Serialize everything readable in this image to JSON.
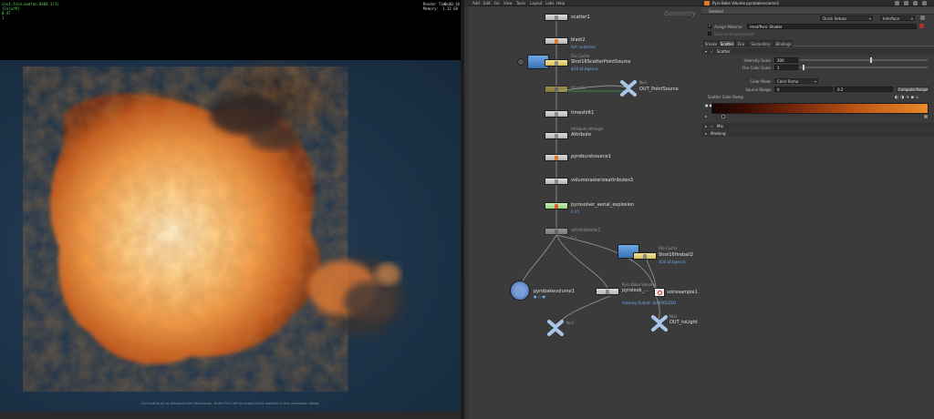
{
  "viewport": {
    "hud_left": [
      "cout.fold.andran.0404.1(1)",
      "[ColorM]",
      "0.47",
      "1"
    ],
    "render_time_label": "Render Time:",
    "render_time_value": "0:00:10",
    "memory_label": "Memory:",
    "memory_value": "1.12 GB",
    "hint_text": "Ctrl+Left to an on detailed pixel information. Shift+Ctrl+Left to inspect focus material in this permission dialog.",
    "colors": {
      "fire_core": "#fff1c9",
      "fire_mid": "#f59a3f",
      "fire_dark": "#a43b10",
      "smoke": "#2f2a28",
      "background": "#1d3349"
    }
  },
  "network": {
    "menu": [
      "Add",
      "Edit",
      "Go",
      "View",
      "Tools",
      "Layout",
      "Labs",
      "Help"
    ],
    "context_label": "Geometry",
    "nodes": [
      {
        "label": "scatter1"
      },
      {
        "label": "blast2",
        "sub": "Act: selection"
      },
      {
        "type": "File Cache",
        "label": "Shot16ScatterPointSource",
        "sub": "$OS.$F.bgeo.sc"
      },
      {
        "label": "blast1"
      },
      {
        "type": "Null",
        "label": "OUT_PointSource"
      },
      {
        "label": "timeshift1"
      },
      {
        "type": "Attribute Wrangle",
        "label": "Attribute"
      },
      {
        "label": "pyroburstsource1"
      },
      {
        "label": "volumerasterizeattributes3"
      },
      {
        "label": "pyrosolver_aerial_explosion",
        "sub": "0.15"
      },
      {
        "label": "attribdelete1",
        "sub": "0.0"
      },
      {
        "type": "File Cache",
        "label": "Shot16fireball2",
        "sub": "$OS.$F.bgeo.sc"
      },
      {
        "label": "pyrobakevolume1"
      },
      {
        "type": "Pyro Bake Volume",
        "label": "pyrolook_...",
        "sub": "Viewing Output: $LOOKSIZED"
      },
      {
        "label": "volresample1"
      },
      {
        "type": "Null",
        "label": ""
      },
      {
        "type": "Null",
        "label": "OUT_toLight"
      }
    ]
  },
  "params": {
    "title": "Pyro Bake Volume  pyrobakevolume1",
    "general_label": "General",
    "quick_setups_label": "Quick Setups",
    "interface_dropdown": "Interface",
    "assign_material_label": "Assign Material",
    "assign_material_value": "/mat/Pyro_Shader",
    "save_as_label": "Save as displacement",
    "tabs": [
      "Smoke",
      "Scatter",
      "Fire",
      "Secondary Fire",
      "Bindings"
    ],
    "active_tab": "Scatter",
    "section_scatter": "Scatter",
    "intensity_label": "Intensity Scale",
    "intensity_value": "200",
    "intensity_fraction": 0.55,
    "fire_color_label": "Fire Color Scale",
    "fire_color_value": "1",
    "fire_color_fraction": 0.02,
    "color_mode_label": "Color Mode",
    "color_mode_value": "Color Ramp",
    "source_range_label": "Source Range",
    "source_range_min": "0",
    "source_range_max": "0.2",
    "compute_range_label": "Compute Range",
    "ramp_label": "Scatter Color Ramp",
    "section_mix": "Mix",
    "section_masking": "Masking",
    "ramp_colors": [
      "#160603",
      "#3a0d05",
      "#7a2a0c",
      "#c25a17",
      "#e9892a"
    ]
  }
}
